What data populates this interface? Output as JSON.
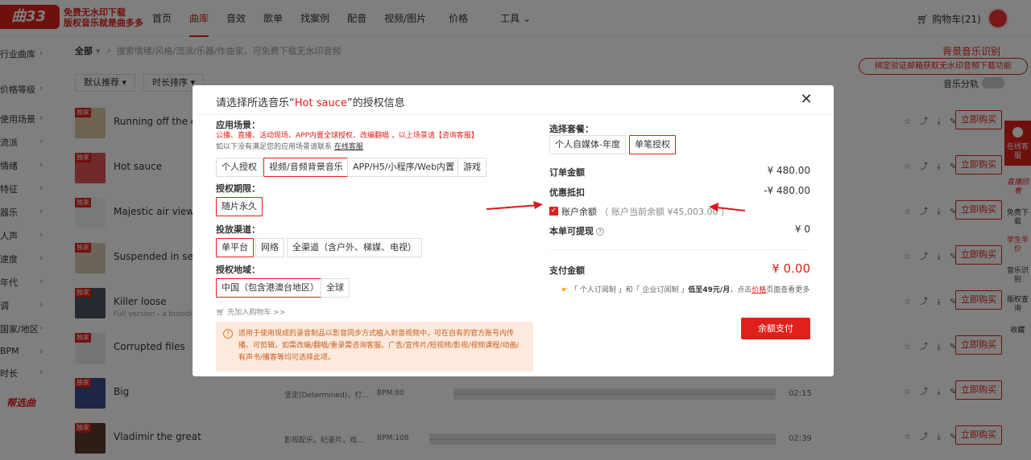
{
  "header": {
    "logo": "曲33",
    "slogan1": "免费无水印下载",
    "slogan2": "版权音乐就是曲多多",
    "nav": [
      "首页",
      "曲库",
      "音效",
      "歌单",
      "找案例",
      "配音",
      "视频/图片",
      "价格",
      "工具"
    ],
    "cart": "购物车(21)"
  },
  "sidebar": {
    "categories": [
      "行业曲库",
      "价格等级",
      "使用场景",
      "流派",
      "情绪",
      "特征",
      "器乐",
      "人声",
      "速度",
      "年代",
      "调",
      "国家/地区",
      "BPM",
      "时长"
    ],
    "helper": "帮选曲"
  },
  "filter": {
    "scope": "全部",
    "search_placeholder": "搜索情绪/风格/流派/乐器/作曲家，可免费下载无水印音频",
    "sort_default": "默认推荐",
    "sort_duration": "时长排序",
    "bgm_recognition": "背景音乐识别",
    "banner": "绑定验证邮箱获取无水印音频下载功能",
    "split_track": "音乐分轨"
  },
  "songs": [
    {
      "badge": "独家",
      "title": "Running off the edg",
      "sub": ""
    },
    {
      "badge": "独家",
      "title": "Hot sauce",
      "sub": ""
    },
    {
      "badge": "独家",
      "title": "Majestic air view",
      "sub": ""
    },
    {
      "badge": "独家",
      "title": "Suspended in sereni",
      "sub": ""
    },
    {
      "badge": "独家",
      "title": "Killer loose",
      "sub": "Full version - a broodin"
    },
    {
      "badge": "独家",
      "title": "Corrupted files",
      "sub": ""
    },
    {
      "badge": "独家",
      "title": "Big",
      "sub": "",
      "tag": "坚定(Determined)，打...",
      "bpm": "BPM:80",
      "dur": "02:15"
    },
    {
      "badge": "独家",
      "title": "Vladimir the great",
      "sub": "",
      "tag": "影视配乐，纪录片，戏...",
      "bpm": "BPM:108",
      "dur": "02:39"
    }
  ],
  "buy_label": "立即购买",
  "right_bar": {
    "service": "在线客服",
    "items": [
      "直播回看",
      "免费下载",
      "学生半价",
      "音乐识别",
      "版权查询",
      "收藏"
    ]
  },
  "modal": {
    "title_prefix": "请选择所选音乐“",
    "song": "Hot sauce",
    "title_suffix": "”的授权信息",
    "scene_label": "应用场景：",
    "scene_note": "公播、直播、活动现场、APP内置全球授权、改编翻唱 ，以上场景请【咨询客服】",
    "scene_note2": "如以下没有满足您的应用场景请联系",
    "scene_link": "在线客服",
    "scene_opts": [
      "个人授权",
      "视频/音频背景音乐",
      "APP/H5/小程序/Web内置",
      "游戏"
    ],
    "period_label": "授权期限：",
    "period_opts": [
      "随片永久"
    ],
    "channel_label": "投放渠道：",
    "channel_opts": [
      "单平台",
      "网络",
      "全渠道（含户外、梯媒、电视）"
    ],
    "region_label": "授权地域：",
    "region_opts": [
      "中国（包含港澳台地区）",
      "全球"
    ],
    "add_cart": "先加入购物车 >>",
    "tip": "适用于使用现成的录音制品以影音同步方式植入到音视频中，可在自有的官方账号内传播。可剪辑，如需改编/翻唱/重录需咨询客服。广告/宣传片/短视频/影视/视频课程/动画/有声书/播客等均可选择此项。",
    "package_label": "选择套餐：",
    "package_opts": [
      "个人自媒体-年度",
      "单笔授权"
    ],
    "order_label": "订单金额",
    "order_value": "¥ 480.00",
    "discount_label": "优惠抵扣",
    "discount_value": "-¥ 480.00",
    "balance_label": "账户余额",
    "balance_note": "（ 账户当前余额 ¥45,003.00 ）",
    "withdraw_label": "本单可提现",
    "withdraw_value": "¥ 0",
    "pay_label": "支付金额",
    "pay_value": "¥ 0.00",
    "sub_note_a": "「 个人订阅制 」和「 企业订阅制 」",
    "sub_note_b": "低至49元/月",
    "sub_note_c": "，点击",
    "sub_note_link": "价格",
    "sub_note_d": "页面查看更多",
    "pay_button": "余额支付"
  },
  "colors": {
    "accent": "#e0201b",
    "tip_bg": "#fde9dd"
  }
}
